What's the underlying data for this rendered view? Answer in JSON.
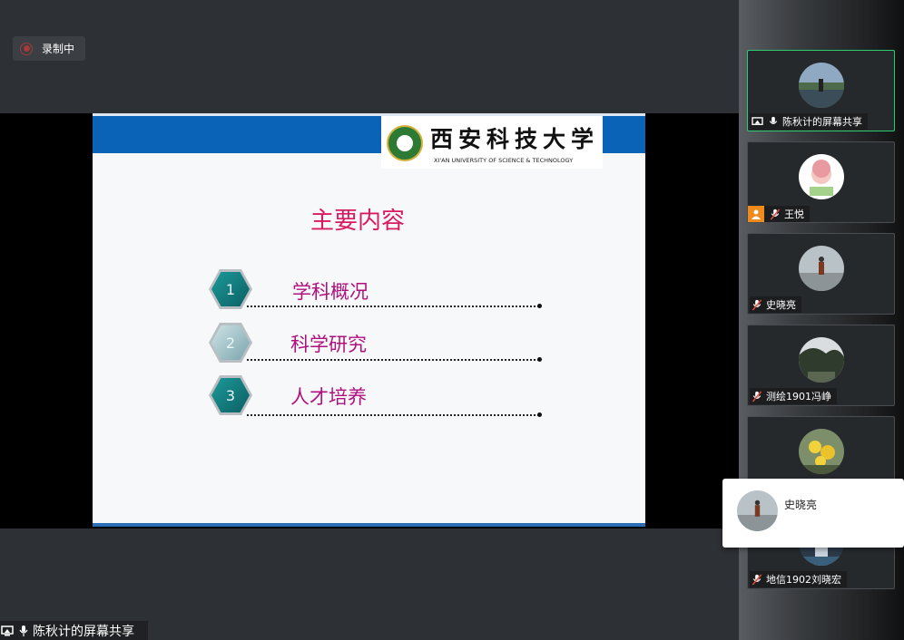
{
  "recording": {
    "label": "录制中"
  },
  "slide": {
    "university_cn": "西安科技大学",
    "university_en": "XI'AN UNIVERSITY OF SCIENCE & TECHNOLOGY",
    "title": "主要内容",
    "items": [
      {
        "number": "1",
        "label": "学科概况"
      },
      {
        "number": "2",
        "label": "科学研究"
      },
      {
        "number": "3",
        "label": "人才培养"
      }
    ]
  },
  "screen_share": {
    "label": "陈秋计的屏幕共享"
  },
  "participants": [
    {
      "name": "陈秋计的屏幕共享",
      "icons": [
        "screen-share-icon",
        "microphone-icon"
      ]
    },
    {
      "name": "王悦",
      "icons": [
        "person-icon",
        "microphone-muted-icon"
      ]
    },
    {
      "name": "史晓亮",
      "icons": [
        "microphone-muted-icon"
      ]
    },
    {
      "name": "测绘1901冯峥",
      "icons": [
        "microphone-muted-icon"
      ]
    },
    {
      "name": "",
      "icons": []
    },
    {
      "name": "地信1902刘晓宏",
      "icons": [
        "microphone-muted-icon"
      ]
    }
  ],
  "popup": {
    "name": "史晓亮"
  },
  "colors": {
    "accent_active": "#2ecc71",
    "slide_title": "#d81b60",
    "slide_item": "#b0107e",
    "slide_band": "#0b63b8"
  }
}
